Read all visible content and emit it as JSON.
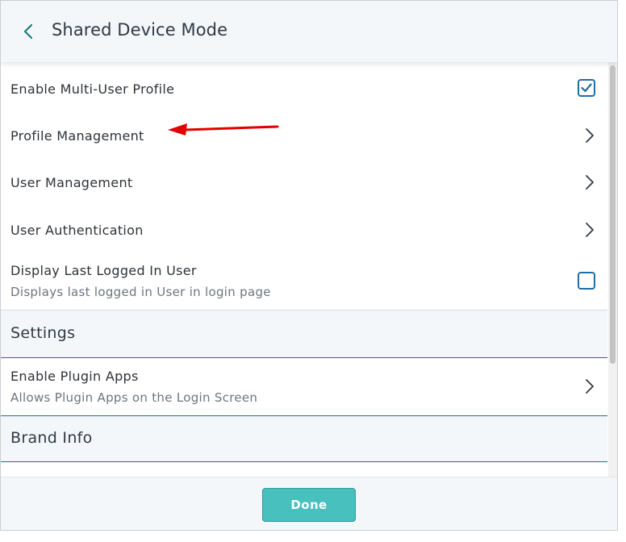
{
  "header": {
    "title": "Shared Device Mode",
    "back_icon": "chevron-left-icon"
  },
  "colors": {
    "accent": "#47c0be",
    "checkbox": "#1d6fa5",
    "annotation_arrow": "#e00000"
  },
  "rows": [
    {
      "label": "Enable Multi-User Profile",
      "control": "checkbox",
      "checked": true
    },
    {
      "label": "Profile Management",
      "control": "chevron"
    },
    {
      "label": "User Management",
      "control": "chevron"
    },
    {
      "label": "User Authentication",
      "control": "chevron"
    },
    {
      "label": "Display Last Logged In User",
      "sublabel": "Displays last logged in User in login page",
      "control": "checkbox",
      "checked": false
    }
  ],
  "sections": [
    {
      "label": "Settings",
      "rows": [
        {
          "label": "Enable Plugin Apps",
          "sublabel": "Allows Plugin Apps on the Login Screen",
          "control": "chevron"
        }
      ]
    },
    {
      "label": "Brand Info",
      "rows": []
    }
  ],
  "footer": {
    "done_label": "Done"
  }
}
